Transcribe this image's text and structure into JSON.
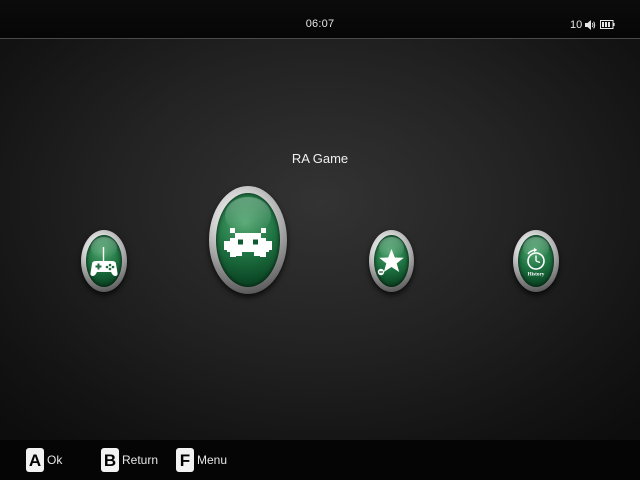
{
  "status_bar": {
    "time": "06:07",
    "volume_level": "10",
    "icons": [
      "speaker-icon",
      "battery-icon"
    ]
  },
  "menu": {
    "selected_title": "RA Game",
    "items": [
      {
        "icon": "gamepad-icon",
        "selected": false
      },
      {
        "icon": "retroarch-invader-icon",
        "selected": true
      },
      {
        "icon": "star-icon",
        "selected": false
      },
      {
        "icon": "history-clock-icon",
        "caption": "History",
        "selected": false
      }
    ]
  },
  "hints": [
    {
      "key": "A",
      "label": "Ok"
    },
    {
      "key": "B",
      "label": "Return"
    },
    {
      "key": "F",
      "label": "Menu"
    }
  ],
  "colors": {
    "background": "#232323",
    "status_bar": "#080808",
    "button_green": "#1f7443",
    "button_ring": "#c8c8c8",
    "hint_key": "#f2f2f2"
  }
}
